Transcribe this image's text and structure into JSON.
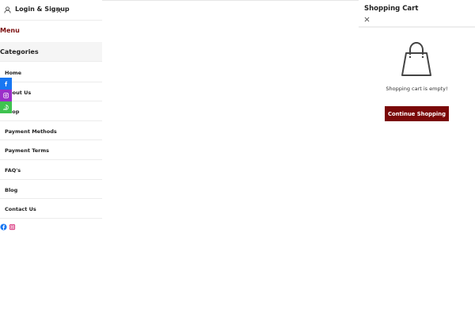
{
  "account": {
    "login_label": "Login & Signup",
    "icons": {
      "user": "user-icon",
      "close": "close-icon"
    }
  },
  "menu": {
    "menu_tab_label": "Menu",
    "categories_tab_label": "Categories",
    "items": [
      {
        "label": "Home"
      },
      {
        "label": "About Us"
      },
      {
        "label": "Shop"
      },
      {
        "label": "Payment Methods"
      },
      {
        "label": "Payment Terms"
      },
      {
        "label": "FAQ's"
      },
      {
        "label": "Blog"
      },
      {
        "label": "Contact Us"
      }
    ],
    "social_icons": [
      "facebook-icon",
      "instagram-icon"
    ]
  },
  "share_bar": {
    "buttons": [
      {
        "icon": "facebook-icon",
        "color": "#1877f2"
      },
      {
        "icon": "instagram-icon",
        "color": "#9b2fc9"
      },
      {
        "icon": "whatsapp-icon",
        "color": "#3fc350"
      }
    ]
  },
  "cart": {
    "title": "Shopping Cart",
    "empty_message": "Shopping cart is empty!",
    "continue_label": "Continue Shopping",
    "icons": {
      "close": "close-icon",
      "bag": "shopping-bag-icon"
    }
  },
  "colors": {
    "accent": "#7a0808",
    "menu_tab": "#7a0c0c",
    "facebook": "#1877f2",
    "instagram": "#9b2fc9",
    "whatsapp": "#3fc350"
  }
}
